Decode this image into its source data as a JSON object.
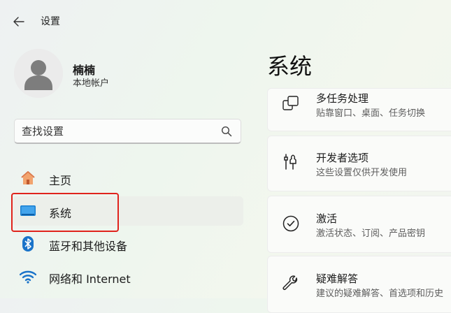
{
  "header": {
    "back_icon": "arrow-left-icon",
    "title": "设置"
  },
  "user": {
    "name": "楠楠",
    "account_type": "本地帐户",
    "avatar_icon": "person-icon"
  },
  "search": {
    "placeholder": "查找设置",
    "value": "",
    "icon": "search-icon"
  },
  "sidebar": {
    "items": [
      {
        "label": "主页",
        "icon": "home-icon"
      },
      {
        "label": "系统",
        "icon": "monitor-icon",
        "selected": true,
        "annotated": true
      },
      {
        "label": "蓝牙和其他设备",
        "icon": "bluetooth-icon"
      },
      {
        "label": "网络和 Internet",
        "icon": "wifi-icon"
      }
    ]
  },
  "main": {
    "title": "系统",
    "cards": [
      {
        "title": "多任务处理",
        "subtitle": "贴靠窗口、桌面、任务切换",
        "icon": "multitasking-icon"
      },
      {
        "title": "开发者选项",
        "subtitle": "这些设置仅供开发使用",
        "icon": "developer-tools-icon"
      },
      {
        "title": "激活",
        "subtitle": "激活状态、订阅、产品密钥",
        "icon": "check-circle-icon"
      },
      {
        "title": "疑难解答",
        "subtitle": "建议的疑难解答、首选项和历史",
        "icon": "wrench-icon"
      }
    ]
  },
  "colors": {
    "annotation_red": "#e0231c",
    "accent_blue": "#0067c0"
  }
}
